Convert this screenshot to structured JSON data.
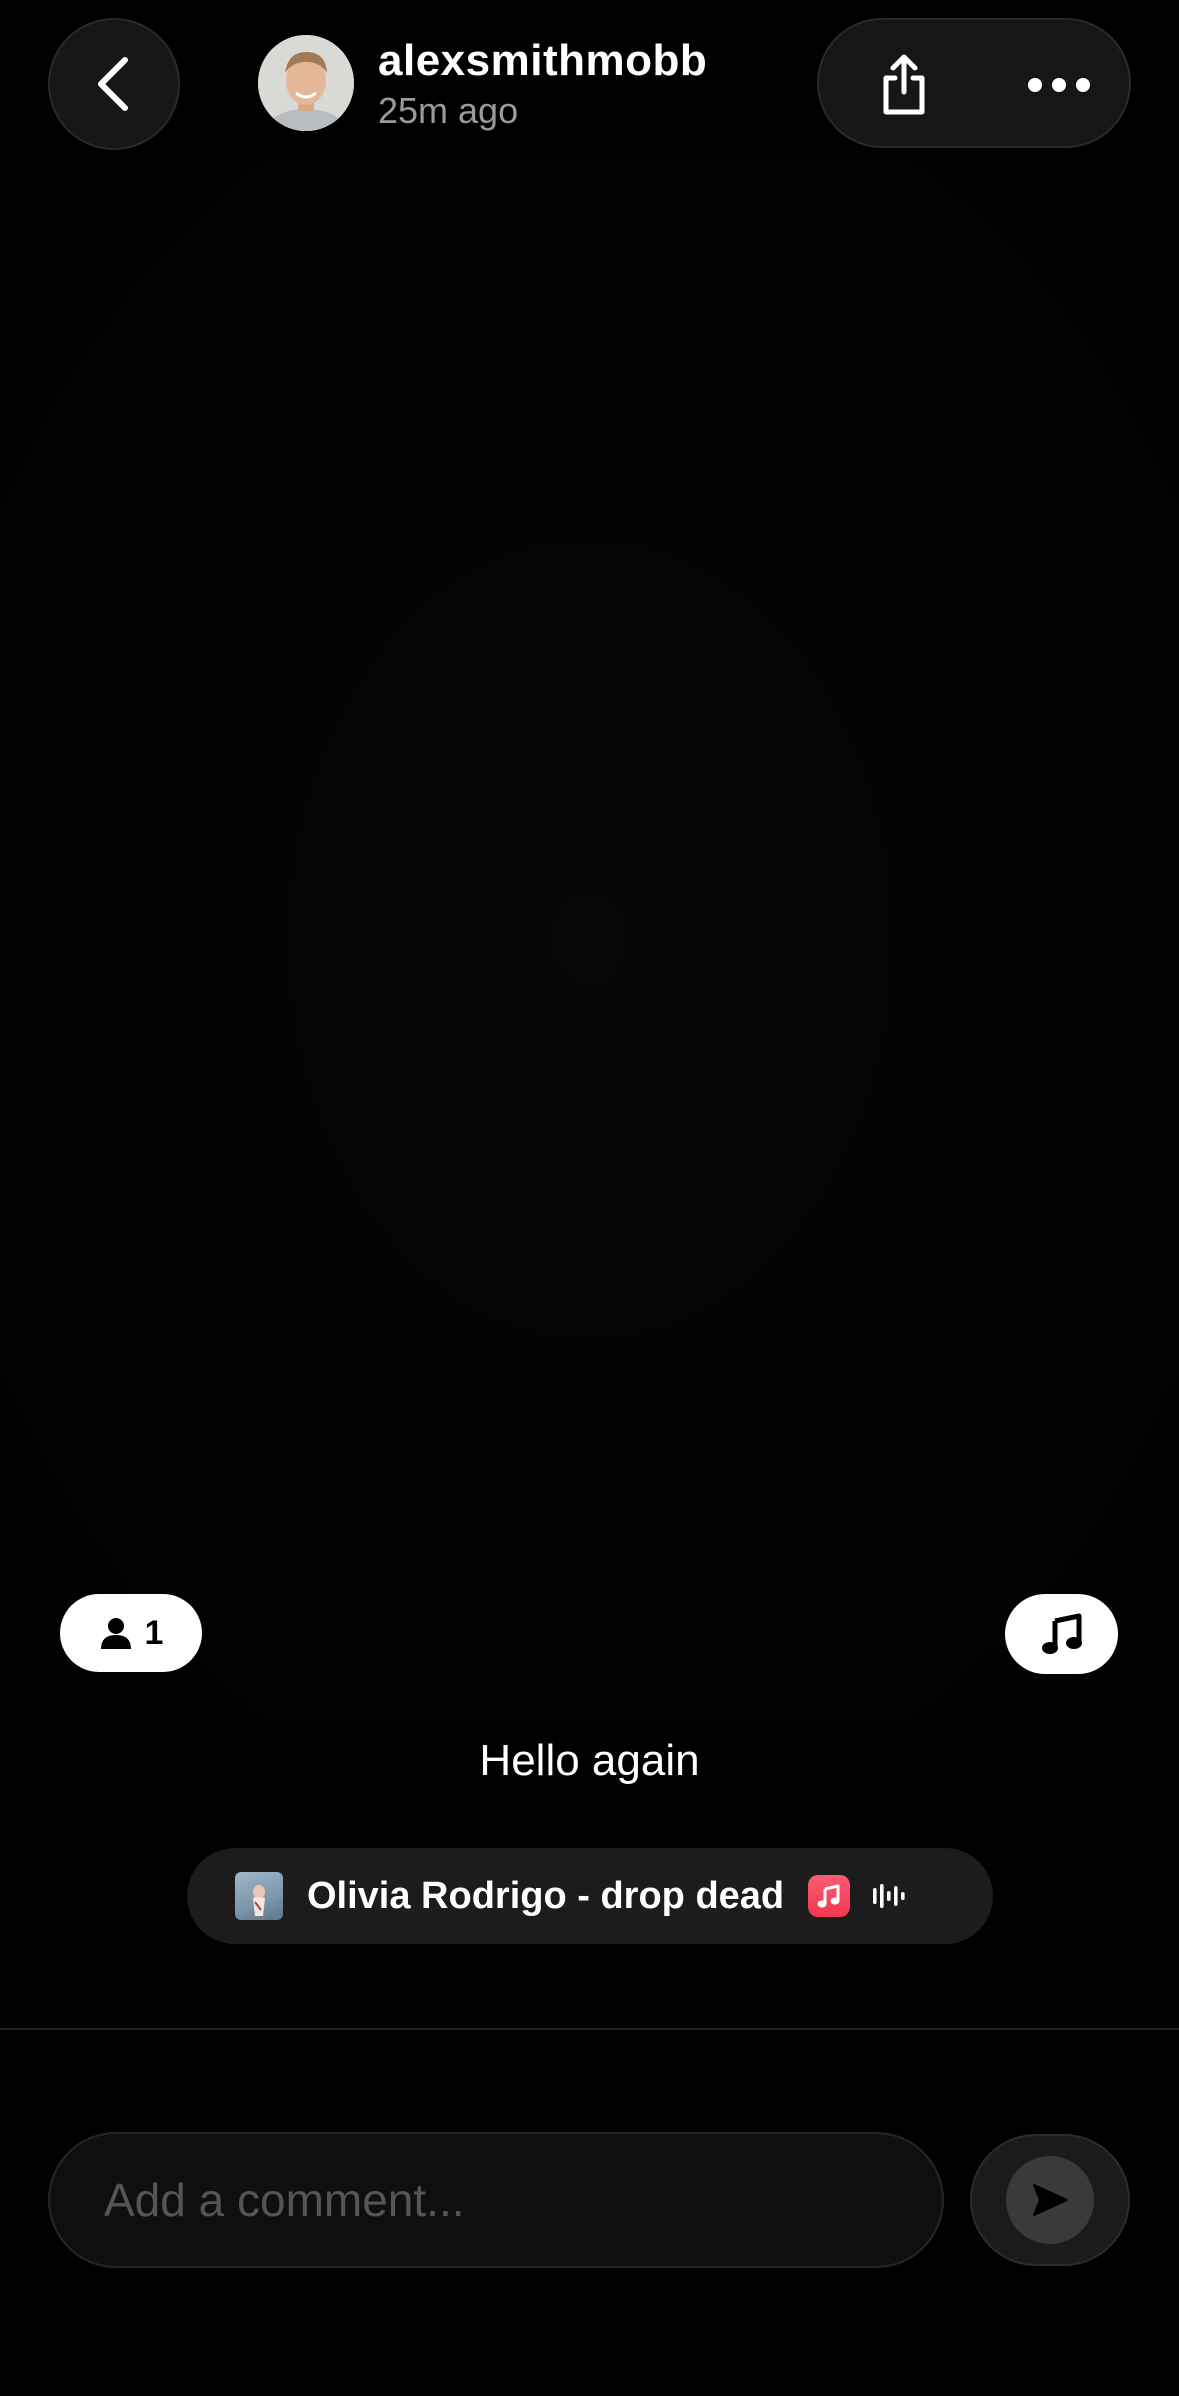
{
  "header": {
    "username": "alexsmithmobb",
    "time_ago": "25m ago"
  },
  "icons": {
    "back": "chevron-left-icon",
    "share": "share-icon",
    "more": "ellipsis-icon",
    "tagged_people": "person-icon",
    "music": "music-note-icon",
    "apple_music": "apple-music-icon",
    "waveform": "waveform-icon",
    "send": "send-icon"
  },
  "post": {
    "tagged_count": "1",
    "caption": "Hello again",
    "song": "Olivia Rodrigo - drop dead"
  },
  "comment": {
    "placeholder": "Add a comment..."
  },
  "colors": {
    "background": "#000000",
    "pill": "#1c1c1c",
    "apple_music_red": "#f1384f",
    "muted_text": "#9a9a9a"
  }
}
